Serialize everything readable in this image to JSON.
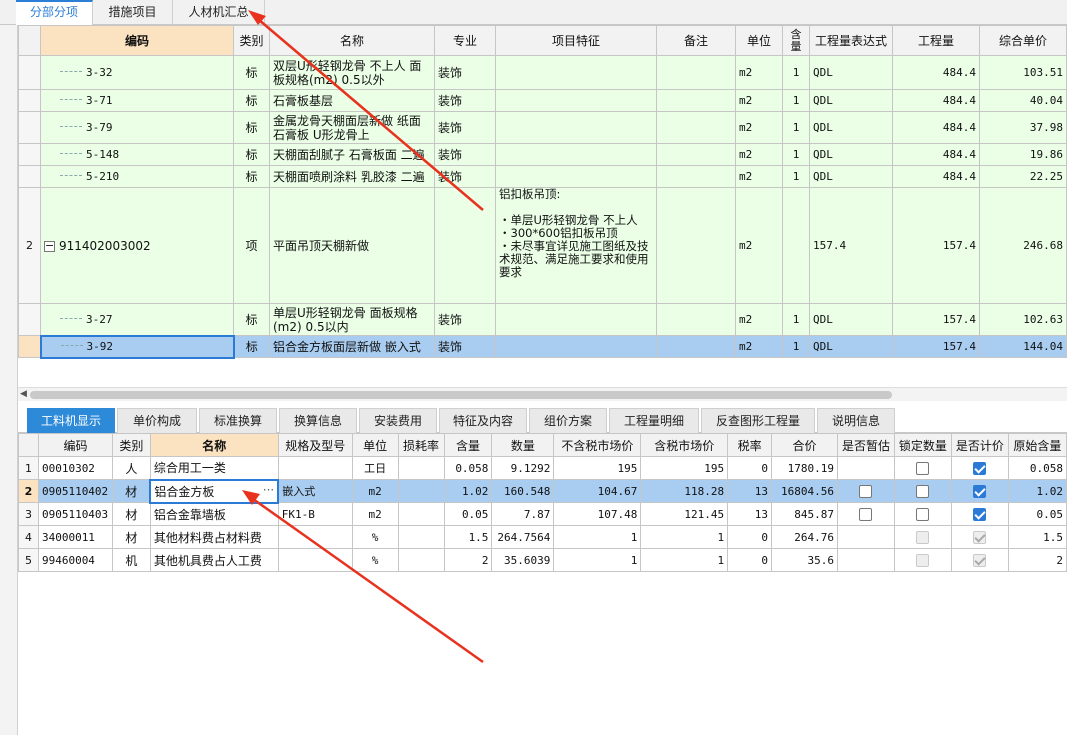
{
  "top_tabs": [
    "分部分项",
    "措施项目",
    "人材机汇总"
  ],
  "upper_table": {
    "headers": [
      "编码",
      "类别",
      "名称",
      "专业",
      "项目特征",
      "备注",
      "单位",
      "含量",
      "工程量表达式",
      "工程量",
      "综合单价"
    ],
    "rows": [
      {
        "rn": "",
        "code": "3-32",
        "type": "标",
        "name": "双层U形轻钢龙骨 不上人 面板规格(m2) 0.5以外",
        "major": "装饰",
        "feature": "",
        "note": "",
        "unit": "m2",
        "qty_ratio": "1",
        "expr": "QDL",
        "qty": "484.4",
        "price": "103.51"
      },
      {
        "rn": "",
        "code": "3-71",
        "type": "标",
        "name": "石膏板基层",
        "major": "装饰",
        "feature": "",
        "note": "",
        "unit": "m2",
        "qty_ratio": "1",
        "expr": "QDL",
        "qty": "484.4",
        "price": "40.04"
      },
      {
        "rn": "",
        "code": "3-79",
        "type": "标",
        "name": "金属龙骨天棚面层新做 纸面石膏板 U形龙骨上",
        "major": "装饰",
        "feature": "",
        "note": "",
        "unit": "m2",
        "qty_ratio": "1",
        "expr": "QDL",
        "qty": "484.4",
        "price": "37.98"
      },
      {
        "rn": "",
        "code": "5-148",
        "type": "标",
        "name": "天棚面刮腻子 石膏板面 二遍",
        "major": "装饰",
        "feature": "",
        "note": "",
        "unit": "m2",
        "qty_ratio": "1",
        "expr": "QDL",
        "qty": "484.4",
        "price": "19.86"
      },
      {
        "rn": "",
        "code": "5-210",
        "type": "标",
        "name": "天棚面喷刷涂料 乳胶漆 二遍",
        "major": "装饰",
        "feature": "",
        "note": "",
        "unit": "m2",
        "qty_ratio": "1",
        "expr": "QDL",
        "qty": "484.4",
        "price": "22.25"
      },
      {
        "rn": "2",
        "code": "911402003002",
        "type": "项",
        "name": "平面吊顶天棚新做",
        "major": "",
        "feature": "铝扣板吊顶:\n\n・单层U形轻钢龙骨 不上人\n・300*600铝扣板吊顶\n・未尽事宜详见施工图纸及技术规范、满足施工要求和使用要求",
        "note": "",
        "unit": "m2",
        "qty_ratio": "",
        "expr": "157.4",
        "qty": "157.4",
        "price": "246.68"
      },
      {
        "rn": "",
        "code": "3-27",
        "type": "标",
        "name": "单层U形轻钢龙骨 面板规格(m2) 0.5以内",
        "major": "装饰",
        "feature": "",
        "note": "",
        "unit": "m2",
        "qty_ratio": "1",
        "expr": "QDL",
        "qty": "157.4",
        "price": "102.63"
      },
      {
        "rn": "",
        "code": "3-92",
        "type": "标",
        "name": "铝合金方板面层新做 嵌入式",
        "major": "装饰",
        "feature": "",
        "note": "",
        "unit": "m2",
        "qty_ratio": "1",
        "expr": "QDL",
        "qty": "157.4",
        "price": "144.04"
      }
    ]
  },
  "bottom_tabs": [
    "工料机显示",
    "单价构成",
    "标准换算",
    "换算信息",
    "安装费用",
    "特征及内容",
    "组价方案",
    "工程量明细",
    "反查图形工程量",
    "说明信息"
  ],
  "lower_table": {
    "headers": [
      "编码",
      "类别",
      "名称",
      "规格及型号",
      "单位",
      "损耗率",
      "含量",
      "数量",
      "不含税市场价",
      "含税市场价",
      "税率",
      "合价",
      "是否暂估",
      "锁定数量",
      "是否计价",
      "原始含量"
    ],
    "rows": [
      {
        "rn": "1",
        "code": "00010302",
        "type": "人",
        "name": "综合用工一类",
        "spec": "",
        "unit": "工日",
        "loss": "",
        "ratio": "0.058",
        "count": "9.1292",
        "price_ex": "195",
        "price_in": "195",
        "tax": "0",
        "total": "1780.19",
        "est": "none",
        "lock": "off",
        "priced": "on",
        "orig": "0.058"
      },
      {
        "rn": "2",
        "code": "0905110402",
        "type": "材",
        "name": "铝合金方板",
        "spec": "嵌入式",
        "unit": "m2",
        "loss": "",
        "ratio": "1.02",
        "count": "160.548",
        "price_ex": "104.67",
        "price_in": "118.28",
        "tax": "13",
        "total": "16804.56",
        "est": "off",
        "lock": "off",
        "priced": "on",
        "orig": "1.02"
      },
      {
        "rn": "3",
        "code": "0905110403",
        "type": "材",
        "name": "铝合金靠墙板",
        "spec": "FK1-B",
        "unit": "m2",
        "loss": "",
        "ratio": "0.05",
        "count": "7.87",
        "price_ex": "107.48",
        "price_in": "121.45",
        "tax": "13",
        "total": "845.87",
        "est": "off",
        "lock": "off",
        "priced": "on",
        "orig": "0.05"
      },
      {
        "rn": "4",
        "code": "34000011",
        "type": "材",
        "name": "其他材料费占材料费",
        "spec": "",
        "unit": "%",
        "loss": "",
        "ratio": "1.5",
        "count": "264.7564",
        "price_ex": "1",
        "price_in": "1",
        "tax": "0",
        "total": "264.76",
        "est": "none",
        "lock": "dis",
        "priced": "dis-on",
        "orig": "1.5"
      },
      {
        "rn": "5",
        "code": "99460004",
        "type": "机",
        "name": "其他机具费占人工费",
        "spec": "",
        "unit": "%",
        "loss": "",
        "ratio": "2",
        "count": "35.6039",
        "price_ex": "1",
        "price_in": "1",
        "tax": "0",
        "total": "35.6",
        "est": "none",
        "lock": "dis",
        "priced": "dis-on",
        "orig": "2"
      }
    ]
  },
  "colors": {
    "accent": "#2c8ad8",
    "row_green": "#eaffe6",
    "row_selected": "#a9cdf0",
    "header_highlight": "#fbe3c2",
    "annotation_arrow": "#e8321e"
  }
}
